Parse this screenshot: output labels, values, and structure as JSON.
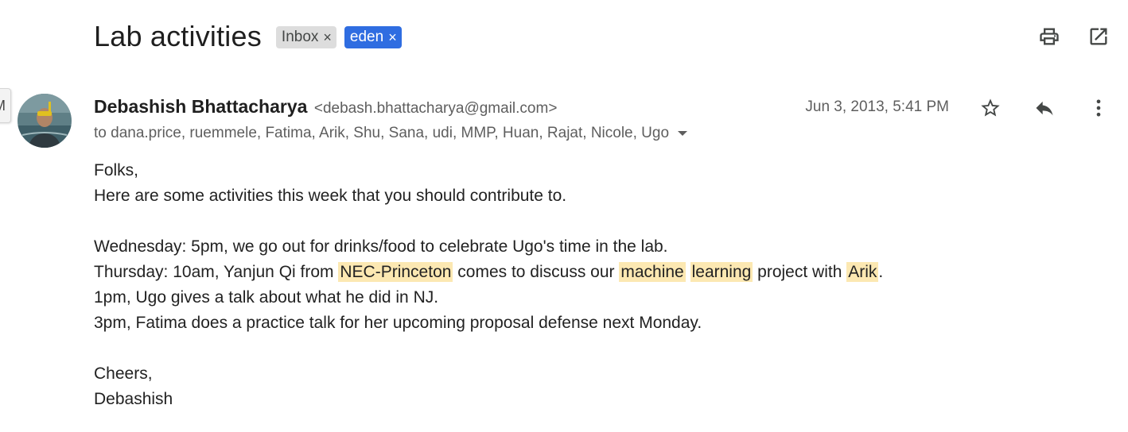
{
  "email": {
    "subject": "Lab activities",
    "labels": [
      {
        "text": "Inbox",
        "bg": "#dddddd"
      },
      {
        "text": "eden",
        "bg": "#2f6de1"
      }
    ],
    "remove_label_glyph": "×",
    "sender_name": "Debashish Bhattacharya",
    "sender_email": "<debash.bhattacharya@gmail.com>",
    "recipients": "to dana.price, ruemmele, Fatima, Arik, Shu, Sana, udi, MMP, Huan, Rajat, Nicole, Ugo",
    "date": "Jun 3, 2013, 5:41 PM",
    "left_tab_text": "M",
    "icons": {
      "print": "print-icon",
      "open_in_new": "open-in-new-window-icon",
      "star": "star-icon",
      "reply": "reply-icon",
      "more": "more-vert-icon",
      "recipients_toggle": "caret-down-icon"
    },
    "highlight_color": "#fce8b2",
    "body": {
      "greeting": "Folks,",
      "intro": "Here are some activities this week that you should contribute to.",
      "wednesday": "Wednesday: 5pm, we go out for drinks/food to celebrate Ugo's time in the lab.",
      "thursday": {
        "t1": "Thursday: 10am, Yanjun Qi from ",
        "h1": "NEC-Princeton",
        "t2": " comes to discuss our ",
        "h2": "machine",
        "t3": " ",
        "h3": "learning",
        "t4": " project with ",
        "h4": "Arik",
        "t5": "."
      },
      "line_1pm": "1pm, Ugo gives a talk about what he did in NJ.",
      "line_3pm": "3pm, Fatima does a practice talk for her upcoming proposal defense next Monday.",
      "signoff": "Cheers,",
      "signature": "Debashish"
    }
  }
}
